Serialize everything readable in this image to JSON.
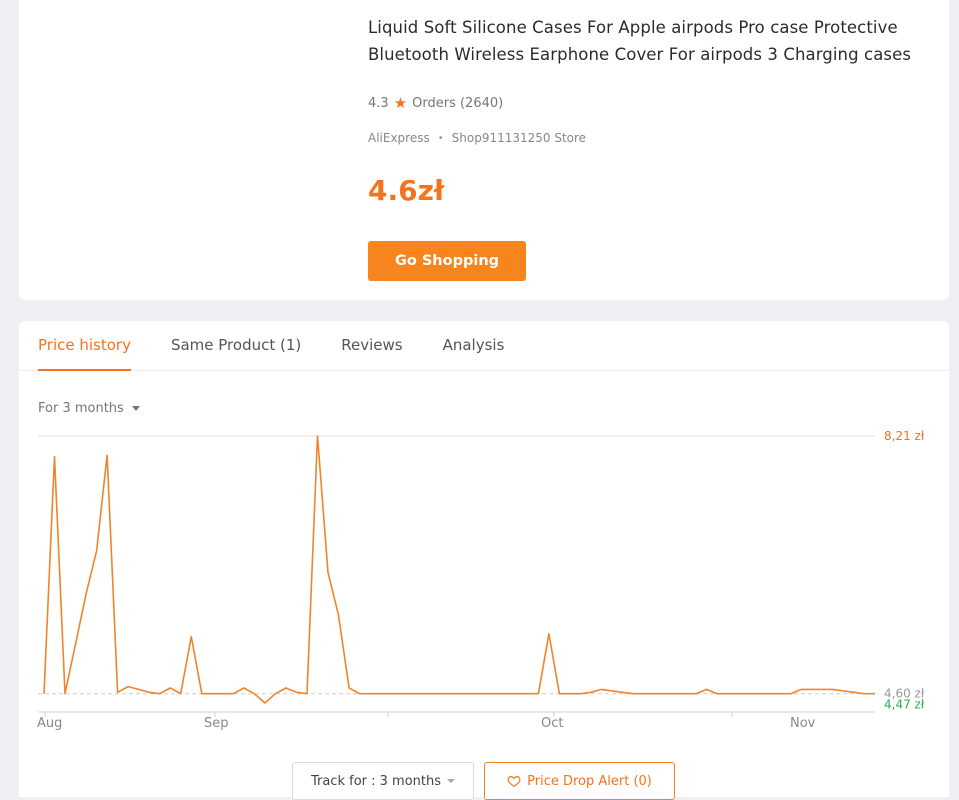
{
  "product": {
    "title": "Liquid Soft Silicone Cases For Apple airpods Pro case Protective Bluetooth Wireless Earphone Cover For airpods 3 Charging cases",
    "rating": "4.3",
    "orders": "Orders (2640)",
    "platform": "AliExpress",
    "store": "Shop911131250 Store",
    "price": "4.6zł",
    "go_label": "Go Shopping"
  },
  "tabs": [
    {
      "label": "Price history"
    },
    {
      "label": "Same Product (1)"
    },
    {
      "label": "Reviews"
    },
    {
      "label": "Analysis"
    }
  ],
  "period_label": "For 3 months",
  "chart_data": {
    "type": "line",
    "x_ticks": [
      "Aug",
      "Sep",
      "Oct",
      "Nov"
    ],
    "max_label": "8,21 zł",
    "current_label": "4,60 zł",
    "min_label": "4,47 zł",
    "ylim": [
      4.33,
      8.21
    ],
    "reference_line": 4.6,
    "x": [
      0,
      1,
      2,
      3,
      4,
      5,
      6,
      7,
      8,
      9,
      10,
      11,
      12,
      13,
      14,
      15,
      16,
      17,
      18,
      19,
      20,
      21,
      22,
      23,
      24,
      25,
      26,
      27,
      28,
      29,
      30,
      31,
      32,
      33,
      34,
      35,
      36,
      37,
      38,
      39,
      40,
      41,
      42,
      43,
      44,
      45,
      46,
      47,
      48,
      49,
      50,
      51,
      52,
      53,
      54,
      55,
      56,
      57,
      58,
      59,
      60,
      61,
      62,
      63,
      64,
      65,
      66,
      67,
      68,
      69,
      70,
      71,
      72,
      73,
      74,
      75,
      76,
      77,
      78,
      79
    ],
    "values": [
      4.6,
      7.92,
      4.6,
      5.3,
      6.0,
      6.6,
      7.94,
      4.62,
      4.7,
      4.66,
      4.62,
      4.6,
      4.68,
      4.6,
      5.4,
      4.6,
      4.6,
      4.6,
      4.6,
      4.68,
      4.6,
      4.47,
      4.6,
      4.68,
      4.62,
      4.6,
      8.21,
      6.3,
      5.7,
      4.68,
      4.6,
      4.6,
      4.6,
      4.6,
      4.6,
      4.6,
      4.6,
      4.6,
      4.6,
      4.6,
      4.6,
      4.6,
      4.6,
      4.6,
      4.6,
      4.6,
      4.6,
      4.6,
      5.44,
      4.6,
      4.6,
      4.6,
      4.62,
      4.66,
      4.64,
      4.62,
      4.6,
      4.6,
      4.6,
      4.6,
      4.6,
      4.6,
      4.6,
      4.66,
      4.6,
      4.6,
      4.6,
      4.6,
      4.6,
      4.6,
      4.6,
      4.6,
      4.66,
      4.66,
      4.66,
      4.66,
      4.64,
      4.62,
      4.6,
      4.6
    ]
  },
  "buttons": {
    "track_label": "Track for : 3 months",
    "alert_label": "Price Drop Alert (0)"
  },
  "colors": {
    "accent": "#f5731c",
    "min_price": "#2bb24c"
  }
}
